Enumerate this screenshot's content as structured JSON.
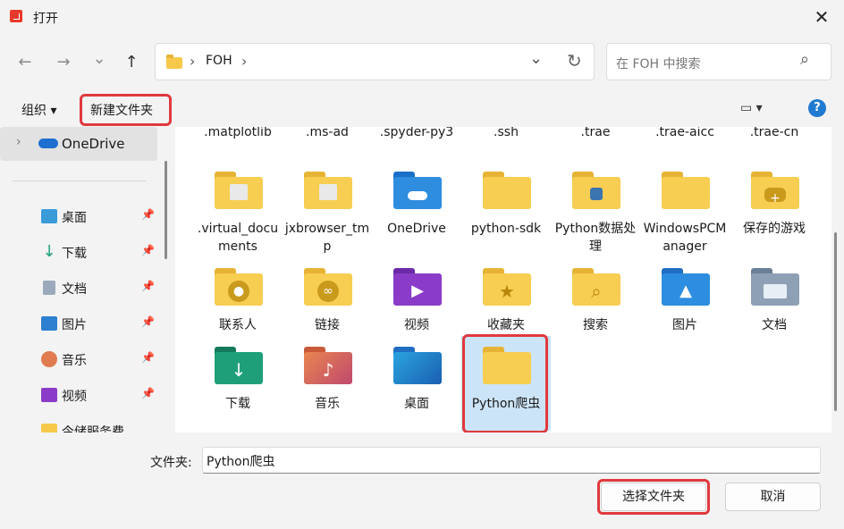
{
  "window": {
    "title": "打开",
    "close_glyph": "✕"
  },
  "nav": {
    "back": "←",
    "forward": "→",
    "recent": "⌄",
    "up": "↑",
    "sep": "›",
    "path": "FOH",
    "path_sep": "›",
    "dropdown": "⌄",
    "refresh": "↻"
  },
  "search": {
    "placeholder": "在 FOH 中搜索",
    "icon": "⌕"
  },
  "toolbar": {
    "organize": "组织 ▾",
    "new_folder": "新建文件夹",
    "view": "▭ ▾",
    "help": "?"
  },
  "sidebar": {
    "onedrive": "OneDrive",
    "items": [
      {
        "label": "桌面",
        "icon": "desktop-icon",
        "color": "#3a9bd8"
      },
      {
        "label": "下载",
        "icon": "download-icon",
        "color": "#1e9f7a"
      },
      {
        "label": "文档",
        "icon": "document-icon",
        "color": "#7a8fa8"
      },
      {
        "label": "图片",
        "icon": "picture-icon",
        "color": "#2d7fd0"
      },
      {
        "label": "音乐",
        "icon": "music-icon",
        "color": "#e07a4f"
      },
      {
        "label": "视频",
        "icon": "video-icon",
        "color": "#8a3cc8"
      },
      {
        "label": "今储服务费",
        "icon": "folder-icon",
        "color": "#f6c94b"
      }
    ],
    "pin": "📌"
  },
  "files": {
    "top_row": [
      ".matplotlib",
      ".ms-ad",
      ".spyder-py3",
      ".ssh",
      ".trae",
      ".trae-aicc",
      ".trae-cn"
    ],
    "grid": [
      {
        "name": ".virtual_documents",
        "icon": "folder-doc-icon"
      },
      {
        "name": "jxbrowser_tmp",
        "icon": "folder-doc-icon"
      },
      {
        "name": "OneDrive",
        "icon": "onedrive-folder-icon"
      },
      {
        "name": "python-sdk",
        "icon": "folder-icon"
      },
      {
        "name": "Python数据处理",
        "icon": "folder-python-icon"
      },
      {
        "name": "WindowsPCManager",
        "icon": "folder-icon"
      },
      {
        "name": "保存的游戏",
        "icon": "saved-games-icon"
      },
      {
        "name": "联系人",
        "icon": "contacts-icon"
      },
      {
        "name": "链接",
        "icon": "links-icon"
      },
      {
        "name": "视频",
        "icon": "videos-icon"
      },
      {
        "name": "收藏夹",
        "icon": "favorites-icon"
      },
      {
        "name": "搜索",
        "icon": "searches-icon"
      },
      {
        "name": "图片",
        "icon": "pictures-icon"
      },
      {
        "name": "文档",
        "icon": "documents-icon"
      },
      {
        "name": "下载",
        "icon": "downloads-icon"
      },
      {
        "name": "音乐",
        "icon": "music-folder-icon"
      },
      {
        "name": "桌面",
        "icon": "desktop-folder-icon"
      },
      {
        "name": "Python爬虫",
        "icon": "folder-icon"
      }
    ]
  },
  "bottom": {
    "label": "文件夹:",
    "value": "Python爬虫",
    "select": "选择文件夹",
    "cancel": "取消"
  }
}
